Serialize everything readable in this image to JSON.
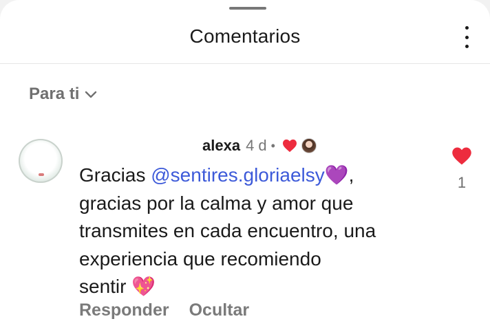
{
  "header": {
    "title": "Comentarios",
    "more_icon": "more-vertical-icon"
  },
  "filter": {
    "label": "Para ti",
    "icon": "chevron-down-icon"
  },
  "comment": {
    "username": "alexa",
    "time": "4 d",
    "separator": "•",
    "text_before": "Gracias ",
    "mention": "@sentires.gloriaelsy",
    "text_after": "💜,\ngracias por la calma y amor que\ntransmites en cada encuentro, una\nexperiencia que recomiendo\nsentir 💖",
    "reply_label": "Responder",
    "hide_label": "Ocultar",
    "like_count": "1"
  },
  "colors": {
    "heart_red": "#ed2c3e",
    "mention_blue": "#3d5ad9",
    "muted_text": "#767676"
  }
}
